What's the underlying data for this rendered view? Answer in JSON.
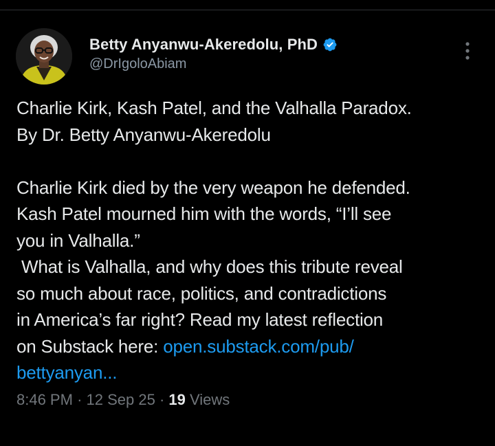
{
  "author": {
    "display_name": "Betty Anyanwu-Akeredolu, PhD",
    "handle": "@DrIgoloAbiam",
    "verified_icon": "verified-badge-icon",
    "avatar_icon": "profile-avatar"
  },
  "tweet": {
    "paragraph1": [
      "Charlie Kirk, Kash Patel, and the Valhalla Paradox.",
      "By Dr. Betty Anyanwu-Akeredolu"
    ],
    "paragraph2": [
      "Charlie Kirk died by the very weapon he defended.",
      "Kash Patel mourned him with the words, “I’ll see",
      "you in Valhalla.”",
      " What is Valhalla, and why does this tribute reveal",
      "so much about race, politics, and contradictions",
      "in America’s far right? Read my latest reflection"
    ],
    "link_prefix": "on Substack here: ",
    "link_text_1": "open.substack.com/pub/",
    "link_text_2": "bettyanyan..."
  },
  "meta": {
    "time": "8:46 PM",
    "separator": "·",
    "date": "12 Sep 25",
    "views_count": "19",
    "views_label": "Views"
  },
  "icons": {
    "more": "more-options-icon"
  },
  "colors": {
    "background": "#000000",
    "text": "#e7e9ea",
    "secondary": "#71767b",
    "link": "#1d9bf0",
    "verified": "#1d9bf0",
    "avatar_jacket": "#c9c21c"
  }
}
